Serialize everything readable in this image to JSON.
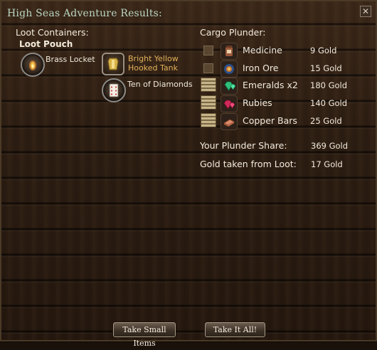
{
  "window": {
    "title": "High Seas Adventure Results:",
    "close_glyph": "✕"
  },
  "loot": {
    "heading": "Loot Containers:",
    "container_name": "Loot Pouch",
    "items": [
      {
        "name": "Brass Locket",
        "icon": "locket-icon",
        "color": "#f2ebdc"
      },
      {
        "name": "Bright Yellow Hooked Tank",
        "icon": "tank-icon",
        "color": "#e3b15a"
      },
      {
        "name": "Ten of Diamonds",
        "icon": "playing-card-icon",
        "color": "#f2ebdc"
      }
    ],
    "tank_line1": "Bright Yellow",
    "tank_line2": "Hooked Tank"
  },
  "cargo": {
    "heading": "Cargo Plunder:",
    "rows": [
      {
        "name": "Medicine",
        "gold": "9 Gold",
        "icon": "medicine-icon",
        "container": "small-box"
      },
      {
        "name": "Iron Ore",
        "gold": "15 Gold",
        "icon": "iron-ore-icon",
        "container": "small-box"
      },
      {
        "name": "Emeralds x2",
        "gold": "180 Gold",
        "icon": "emeralds-icon",
        "container": "crate"
      },
      {
        "name": "Rubies",
        "gold": "140 Gold",
        "icon": "rubies-icon",
        "container": "crate"
      },
      {
        "name": "Copper Bars",
        "gold": "25 Gold",
        "icon": "copper-bars-icon",
        "container": "crate"
      }
    ]
  },
  "summary": {
    "share_label": "Your Plunder Share:",
    "share_value": "369 Gold",
    "taken_label": "Gold taken from Loot:",
    "taken_value": "17 Gold"
  },
  "buttons": {
    "take_small": "Take Small Items",
    "take_all": "Take It All!"
  },
  "colors": {
    "title": "#b9d6c2",
    "text": "#f2ebdc",
    "highlight": "#e3b15a"
  }
}
